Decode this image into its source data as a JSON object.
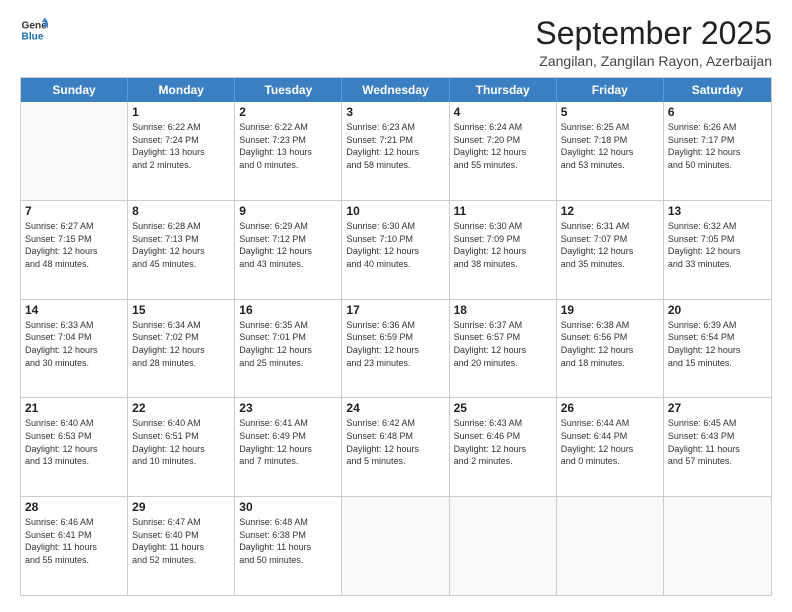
{
  "logo": {
    "line1": "General",
    "line2": "Blue"
  },
  "title": "September 2025",
  "subtitle": "Zangilan, Zangilan Rayon, Azerbaijan",
  "header_days": [
    "Sunday",
    "Monday",
    "Tuesday",
    "Wednesday",
    "Thursday",
    "Friday",
    "Saturday"
  ],
  "rows": [
    [
      {
        "day": "",
        "lines": []
      },
      {
        "day": "1",
        "lines": [
          "Sunrise: 6:22 AM",
          "Sunset: 7:24 PM",
          "Daylight: 13 hours",
          "and 2 minutes."
        ]
      },
      {
        "day": "2",
        "lines": [
          "Sunrise: 6:22 AM",
          "Sunset: 7:23 PM",
          "Daylight: 13 hours",
          "and 0 minutes."
        ]
      },
      {
        "day": "3",
        "lines": [
          "Sunrise: 6:23 AM",
          "Sunset: 7:21 PM",
          "Daylight: 12 hours",
          "and 58 minutes."
        ]
      },
      {
        "day": "4",
        "lines": [
          "Sunrise: 6:24 AM",
          "Sunset: 7:20 PM",
          "Daylight: 12 hours",
          "and 55 minutes."
        ]
      },
      {
        "day": "5",
        "lines": [
          "Sunrise: 6:25 AM",
          "Sunset: 7:18 PM",
          "Daylight: 12 hours",
          "and 53 minutes."
        ]
      },
      {
        "day": "6",
        "lines": [
          "Sunrise: 6:26 AM",
          "Sunset: 7:17 PM",
          "Daylight: 12 hours",
          "and 50 minutes."
        ]
      }
    ],
    [
      {
        "day": "7",
        "lines": [
          "Sunrise: 6:27 AM",
          "Sunset: 7:15 PM",
          "Daylight: 12 hours",
          "and 48 minutes."
        ]
      },
      {
        "day": "8",
        "lines": [
          "Sunrise: 6:28 AM",
          "Sunset: 7:13 PM",
          "Daylight: 12 hours",
          "and 45 minutes."
        ]
      },
      {
        "day": "9",
        "lines": [
          "Sunrise: 6:29 AM",
          "Sunset: 7:12 PM",
          "Daylight: 12 hours",
          "and 43 minutes."
        ]
      },
      {
        "day": "10",
        "lines": [
          "Sunrise: 6:30 AM",
          "Sunset: 7:10 PM",
          "Daylight: 12 hours",
          "and 40 minutes."
        ]
      },
      {
        "day": "11",
        "lines": [
          "Sunrise: 6:30 AM",
          "Sunset: 7:09 PM",
          "Daylight: 12 hours",
          "and 38 minutes."
        ]
      },
      {
        "day": "12",
        "lines": [
          "Sunrise: 6:31 AM",
          "Sunset: 7:07 PM",
          "Daylight: 12 hours",
          "and 35 minutes."
        ]
      },
      {
        "day": "13",
        "lines": [
          "Sunrise: 6:32 AM",
          "Sunset: 7:05 PM",
          "Daylight: 12 hours",
          "and 33 minutes."
        ]
      }
    ],
    [
      {
        "day": "14",
        "lines": [
          "Sunrise: 6:33 AM",
          "Sunset: 7:04 PM",
          "Daylight: 12 hours",
          "and 30 minutes."
        ]
      },
      {
        "day": "15",
        "lines": [
          "Sunrise: 6:34 AM",
          "Sunset: 7:02 PM",
          "Daylight: 12 hours",
          "and 28 minutes."
        ]
      },
      {
        "day": "16",
        "lines": [
          "Sunrise: 6:35 AM",
          "Sunset: 7:01 PM",
          "Daylight: 12 hours",
          "and 25 minutes."
        ]
      },
      {
        "day": "17",
        "lines": [
          "Sunrise: 6:36 AM",
          "Sunset: 6:59 PM",
          "Daylight: 12 hours",
          "and 23 minutes."
        ]
      },
      {
        "day": "18",
        "lines": [
          "Sunrise: 6:37 AM",
          "Sunset: 6:57 PM",
          "Daylight: 12 hours",
          "and 20 minutes."
        ]
      },
      {
        "day": "19",
        "lines": [
          "Sunrise: 6:38 AM",
          "Sunset: 6:56 PM",
          "Daylight: 12 hours",
          "and 18 minutes."
        ]
      },
      {
        "day": "20",
        "lines": [
          "Sunrise: 6:39 AM",
          "Sunset: 6:54 PM",
          "Daylight: 12 hours",
          "and 15 minutes."
        ]
      }
    ],
    [
      {
        "day": "21",
        "lines": [
          "Sunrise: 6:40 AM",
          "Sunset: 6:53 PM",
          "Daylight: 12 hours",
          "and 13 minutes."
        ]
      },
      {
        "day": "22",
        "lines": [
          "Sunrise: 6:40 AM",
          "Sunset: 6:51 PM",
          "Daylight: 12 hours",
          "and 10 minutes."
        ]
      },
      {
        "day": "23",
        "lines": [
          "Sunrise: 6:41 AM",
          "Sunset: 6:49 PM",
          "Daylight: 12 hours",
          "and 7 minutes."
        ]
      },
      {
        "day": "24",
        "lines": [
          "Sunrise: 6:42 AM",
          "Sunset: 6:48 PM",
          "Daylight: 12 hours",
          "and 5 minutes."
        ]
      },
      {
        "day": "25",
        "lines": [
          "Sunrise: 6:43 AM",
          "Sunset: 6:46 PM",
          "Daylight: 12 hours",
          "and 2 minutes."
        ]
      },
      {
        "day": "26",
        "lines": [
          "Sunrise: 6:44 AM",
          "Sunset: 6:44 PM",
          "Daylight: 12 hours",
          "and 0 minutes."
        ]
      },
      {
        "day": "27",
        "lines": [
          "Sunrise: 6:45 AM",
          "Sunset: 6:43 PM",
          "Daylight: 11 hours",
          "and 57 minutes."
        ]
      }
    ],
    [
      {
        "day": "28",
        "lines": [
          "Sunrise: 6:46 AM",
          "Sunset: 6:41 PM",
          "Daylight: 11 hours",
          "and 55 minutes."
        ]
      },
      {
        "day": "29",
        "lines": [
          "Sunrise: 6:47 AM",
          "Sunset: 6:40 PM",
          "Daylight: 11 hours",
          "and 52 minutes."
        ]
      },
      {
        "day": "30",
        "lines": [
          "Sunrise: 6:48 AM",
          "Sunset: 6:38 PM",
          "Daylight: 11 hours",
          "and 50 minutes."
        ]
      },
      {
        "day": "",
        "lines": []
      },
      {
        "day": "",
        "lines": []
      },
      {
        "day": "",
        "lines": []
      },
      {
        "day": "",
        "lines": []
      }
    ]
  ]
}
